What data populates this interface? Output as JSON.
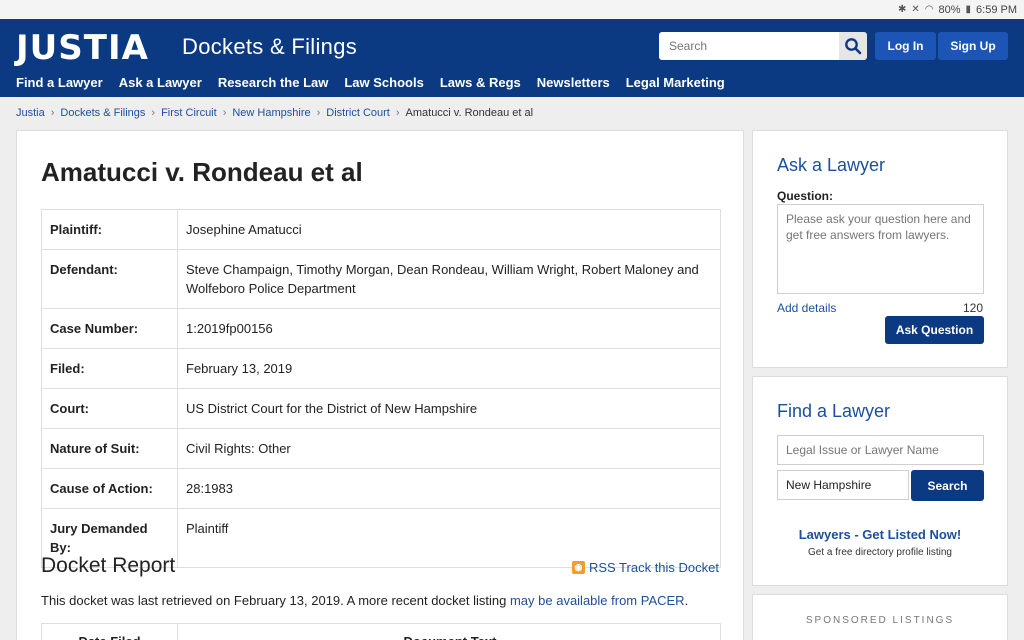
{
  "status_bar": {
    "icons": [
      "bluetooth-icon",
      "mute-icon",
      "wifi-icon",
      "battery-icon"
    ],
    "battery": "80%",
    "time": "6:59 PM"
  },
  "header": {
    "logo": "JUSTIA",
    "site_title": "Dockets & Filings",
    "search_placeholder": "Search",
    "login_label": "Log In",
    "signup_label": "Sign Up",
    "nav": [
      "Find a Lawyer",
      "Ask a Lawyer",
      "Research the Law",
      "Law Schools",
      "Laws & Regs",
      "Newsletters",
      "Legal Marketing"
    ]
  },
  "breadcrumb": {
    "items": [
      "Justia",
      "Dockets & Filings",
      "First Circuit",
      "New Hampshire",
      "District Court"
    ],
    "current": "Amatucci v. Rondeau et al",
    "separator": "›"
  },
  "case": {
    "title": "Amatucci v. Rondeau et al",
    "rows": [
      {
        "label": "Plaintiff:",
        "value": "Josephine Amatucci"
      },
      {
        "label": "Defendant:",
        "value": "Steve Champaign, Timothy Morgan, Dean Rondeau, William Wright, Robert Maloney and Wolfeboro Police Department"
      },
      {
        "label": "Case Number:",
        "value": "1:2019fp00156"
      },
      {
        "label": "Filed:",
        "value": "February 13, 2019"
      },
      {
        "label": "Court:",
        "value": "US District Court for the District of New Hampshire"
      },
      {
        "label": "Nature of Suit:",
        "value": "Civil Rights: Other"
      },
      {
        "label": "Cause of Action:",
        "value": "28:1983"
      },
      {
        "label": "Jury Demanded By:",
        "value": "Plaintiff"
      }
    ]
  },
  "docket": {
    "heading": "Docket Report",
    "rss_label": "RSS Track this Docket",
    "retrieved_text": "This docket was last retrieved on February 13, 2019. A more recent docket listing ",
    "pacer_link": "may be available from PACER",
    "retrieved_end": ".",
    "columns": [
      "Date Filed",
      "Document Text"
    ]
  },
  "ask_lawyer": {
    "title": "Ask a Lawyer",
    "question_label": "Question:",
    "placeholder": "Please ask your question here and get free answers from lawyers.",
    "add_details": "Add details",
    "char_count": "120",
    "button": "Ask Question"
  },
  "find_lawyer": {
    "title": "Find a Lawyer",
    "issue_placeholder": "Legal Issue or Lawyer Name",
    "location_value": "New Hampshire",
    "button": "Search",
    "listed_link": "Lawyers - Get Listed Now!",
    "listed_sub": "Get a free directory profile listing"
  },
  "sponsored": {
    "label": "SPONSORED LISTINGS"
  }
}
